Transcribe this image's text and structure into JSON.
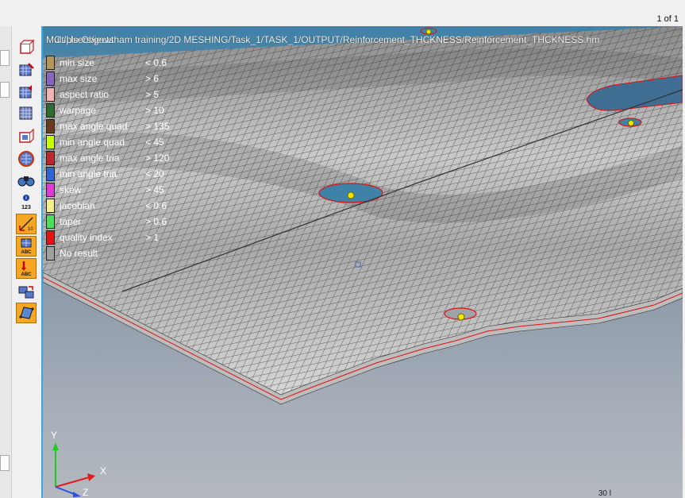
{
  "page_indicator": "1 of 1",
  "title": "Multiple Objects",
  "file_path": "...C:/Users/gowtham training/2D MESHING/Task_1/TASK_1/OUTPUT/Reinforcement_THCKNESS/Reinforcement_THCKNESS.hm",
  "legend": [
    {
      "label": "min size",
      "threshold": "< 0.6",
      "color": "#b39659"
    },
    {
      "label": "max size",
      "threshold": "> 6",
      "color": "#8866c0"
    },
    {
      "label": "aspect ratio",
      "threshold": "> 5",
      "color": "#f4b3b3"
    },
    {
      "label": "warpage",
      "threshold": "> 10",
      "color": "#2e6b2e"
    },
    {
      "label": "max angle quad",
      "threshold": "> 135",
      "color": "#6b3a1f"
    },
    {
      "label": "min angle quad",
      "threshold": "< 45",
      "color": "#c8ff00"
    },
    {
      "label": "max angle tria",
      "threshold": "> 120",
      "color": "#c0262e"
    },
    {
      "label": "min angle tria",
      "threshold": "< 20",
      "color": "#2f63d6"
    },
    {
      "label": "skew",
      "threshold": "> 45",
      "color": "#e13ad6"
    },
    {
      "label": "jacobian",
      "threshold": "< 0.6",
      "color": "#f4ef8a"
    },
    {
      "label": "taper",
      "threshold": "> 0.6",
      "color": "#4be05a"
    },
    {
      "label": "quality index",
      "threshold": "> 1",
      "color": "#e31313"
    },
    {
      "label": "No result",
      "threshold": "",
      "color": "#a0a0a0"
    }
  ],
  "triad": {
    "x": "X",
    "y": "Y",
    "z": "Z"
  },
  "bottom_note": "30 l",
  "toolbar": [
    {
      "name": "tool-3d-box-icon",
      "active": false
    },
    {
      "name": "tool-grid-box-icon",
      "active": false
    },
    {
      "name": "tool-grid-arrow-icon",
      "active": false
    },
    {
      "name": "tool-mesh-box-icon",
      "active": false
    },
    {
      "name": "tool-element-box-icon",
      "active": false
    },
    {
      "name": "tool-circle-mesh-icon",
      "active": false
    },
    {
      "name": "binoculars-icon",
      "active": false
    },
    {
      "name": "info-123-icon",
      "active": false
    },
    {
      "name": "measure-icon",
      "active": true
    },
    {
      "name": "abc-label-icon",
      "active": true
    },
    {
      "name": "abc-arrow-icon",
      "active": true
    },
    {
      "name": "swap-icon",
      "active": false
    },
    {
      "name": "surface-icon",
      "active": true
    }
  ]
}
